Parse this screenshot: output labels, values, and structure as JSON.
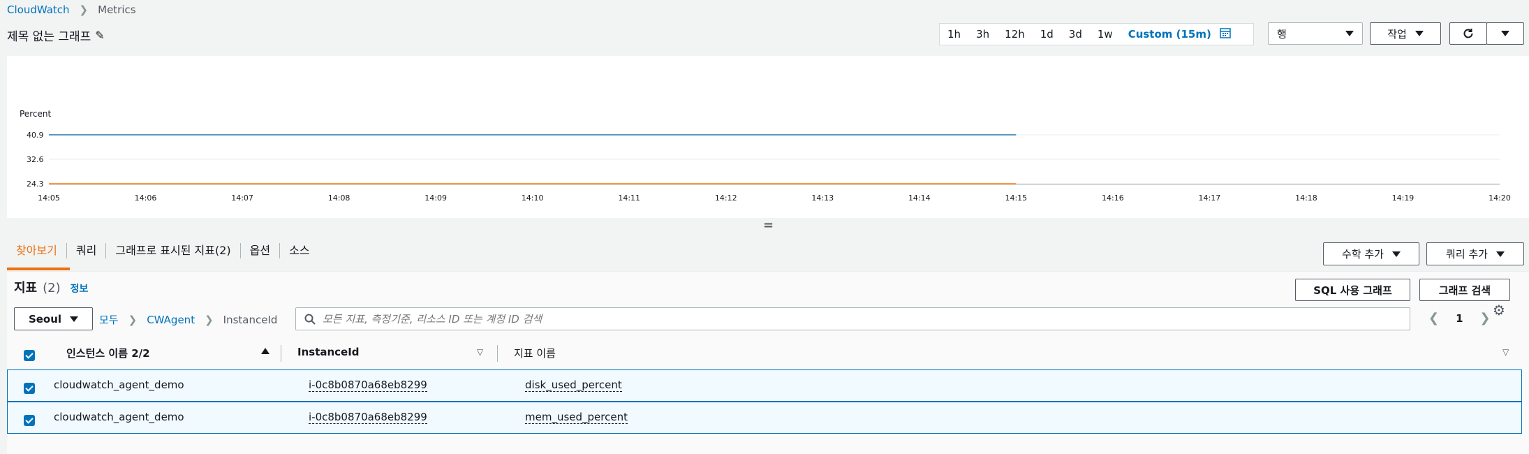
{
  "breadcrumb": {
    "root": "CloudWatch",
    "current": "Metrics"
  },
  "graph_title": "제목 없는 그래프",
  "time_range": {
    "options": [
      "1h",
      "3h",
      "12h",
      "1d",
      "3d",
      "1w"
    ],
    "custom": "Custom (15m)"
  },
  "view_select": "행",
  "actions_label": "작업",
  "chart_data": {
    "type": "line",
    "ylabel": "Percent",
    "y_ticks": [
      "40.9",
      "32.6",
      "24.3"
    ],
    "x_ticks": [
      "14:05",
      "14:06",
      "14:07",
      "14:08",
      "14:09",
      "14:10",
      "14:11",
      "14:12",
      "14:13",
      "14:14",
      "14:15",
      "14:16",
      "14:17",
      "14:18",
      "14:19",
      "14:20"
    ],
    "ylim": [
      24.3,
      40.9
    ],
    "series": [
      {
        "color": "#1f77b4",
        "x": [
          "14:05",
          "14:15"
        ],
        "values": [
          40.9,
          40.9
        ]
      },
      {
        "color": "#ff7f0e",
        "x": [
          "14:05",
          "14:15"
        ],
        "values": [
          24.3,
          24.3
        ]
      }
    ],
    "grid": true
  },
  "resize_handle": "=",
  "tabs": [
    "찾아보기",
    "쿼리",
    "그래프로 표시된 지표(2)",
    "옵션",
    "소스"
  ],
  "math_button": "수학 추가",
  "query_button": "쿼리 추가",
  "metrics": {
    "title": "지표",
    "count": "(2)",
    "info": "정보"
  },
  "sql_button": "SQL 사용 그래프",
  "graph_search_button": "그래프 검색",
  "region": "Seoul",
  "path": [
    "모두",
    "CWAgent",
    "InstanceId"
  ],
  "search": {
    "placeholder": "모든 지표, 측정기준, 리소스 ID 또는 계정 ID 검색"
  },
  "pagination": {
    "page": "1"
  },
  "table": {
    "headers": [
      "인스턴스 이름 2/2",
      "InstanceId",
      "지표 이름"
    ],
    "rows": [
      {
        "name": "cloudwatch_agent_demo",
        "instance": "i-0c8b0870a68eb8299",
        "metric": "disk_used_percent"
      },
      {
        "name": "cloudwatch_agent_demo",
        "instance": "i-0c8b0870a68eb8299",
        "metric": "mem_used_percent"
      }
    ]
  },
  "colors": {
    "accent": "#0073bb",
    "active_tab": "#ec7211",
    "series1": "#1f77b4",
    "series2": "#ff7f0e"
  }
}
